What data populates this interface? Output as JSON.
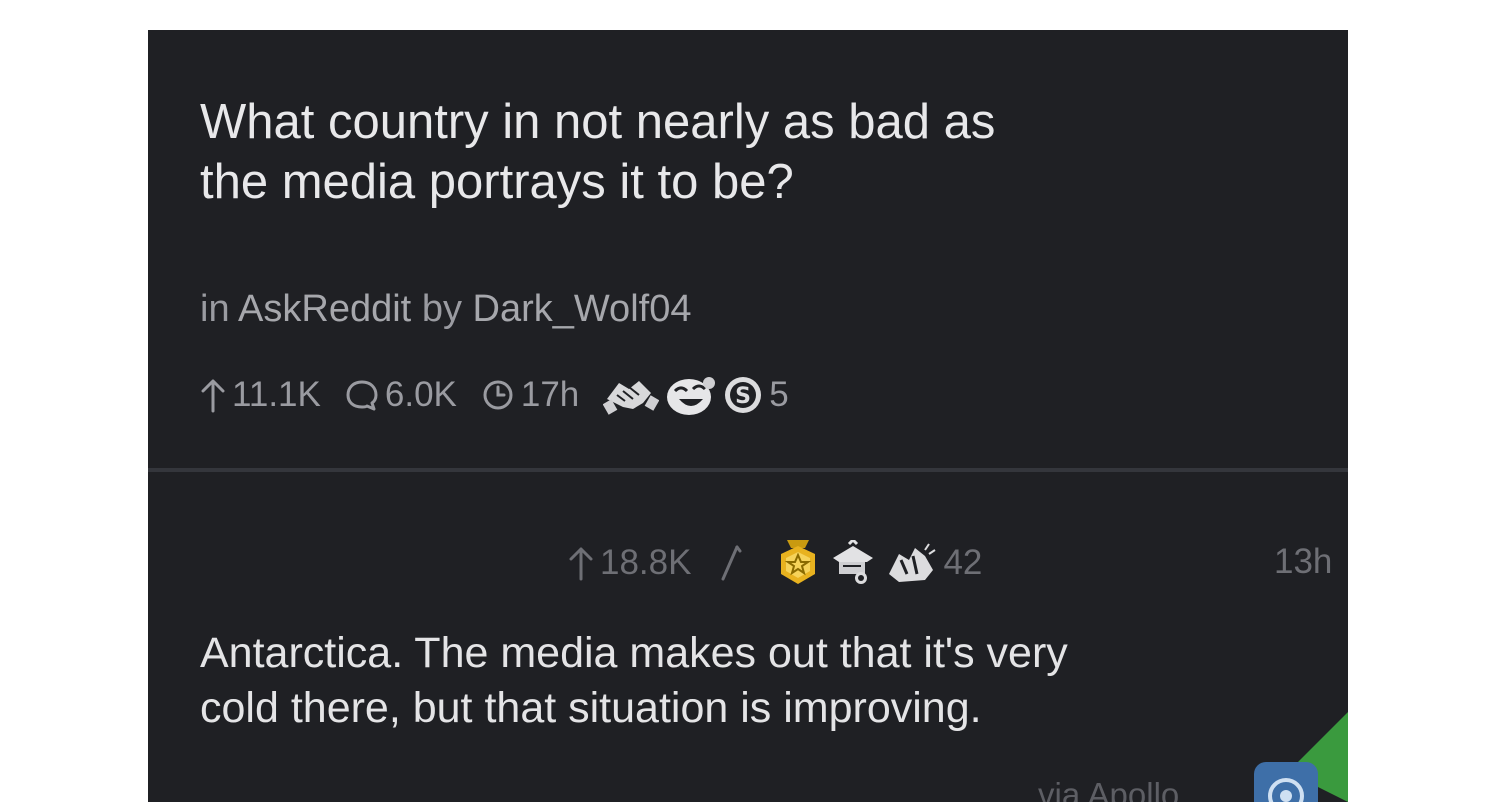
{
  "post": {
    "title_line1": "What country in not nearly as bad as",
    "title_line2": "the media portrays it to be?",
    "meta_in": "in",
    "subreddit": "AskReddit",
    "meta_by": "by",
    "author": "Dark_Wolf04",
    "upvotes": "11.1K",
    "comments": "6.0K",
    "age": "17h",
    "award_count": "5"
  },
  "comment": {
    "upvotes": "18.8K",
    "award_count": "42",
    "age": "13h",
    "body_line1": "Antarctica. The media makes out that it's very",
    "body_line2": "cold there, but that situation is improving.",
    "via": "via Apollo"
  },
  "colors": {
    "background": "#1f2024",
    "title_text": "#e8e8ea",
    "meta_text": "#9a9ba1",
    "accent_green": "#3a9a3e",
    "award_gold": "#e8b21f"
  },
  "icons": {
    "upvote": "arrow-up-icon",
    "comments": "speech-bubble-icon",
    "time": "clock-icon",
    "awards_post": [
      "handshake-award-icon",
      "laughing-face-award-icon",
      "silver-coin-award-icon"
    ],
    "awards_comment": [
      "gold-medal-award-icon",
      "knight-helmet-award-icon",
      "gesture-award-icon"
    ],
    "edited": "pencil-slash-icon",
    "app": "apollo-app-icon"
  }
}
